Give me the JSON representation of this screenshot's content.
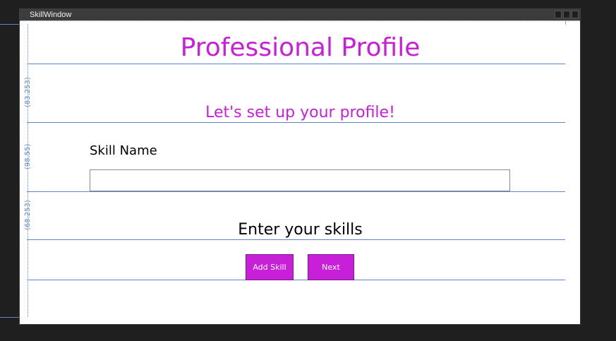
{
  "window": {
    "title": "SkillWindow"
  },
  "rulers": {
    "row1": "(83.253)",
    "row2": "(98.55)",
    "row3": "(68.253)"
  },
  "content": {
    "title": "Professional Profile",
    "subtitle": "Let's set up your profile!",
    "skill_label": "Skill Name",
    "skill_input_value": "",
    "skills_heading": "Enter your skills",
    "add_skill_label": "Add Skill",
    "next_label": "Next"
  },
  "colors": {
    "accent": "#c81fd8",
    "guide": "#5b87c9",
    "background": "#1f1f1f"
  }
}
